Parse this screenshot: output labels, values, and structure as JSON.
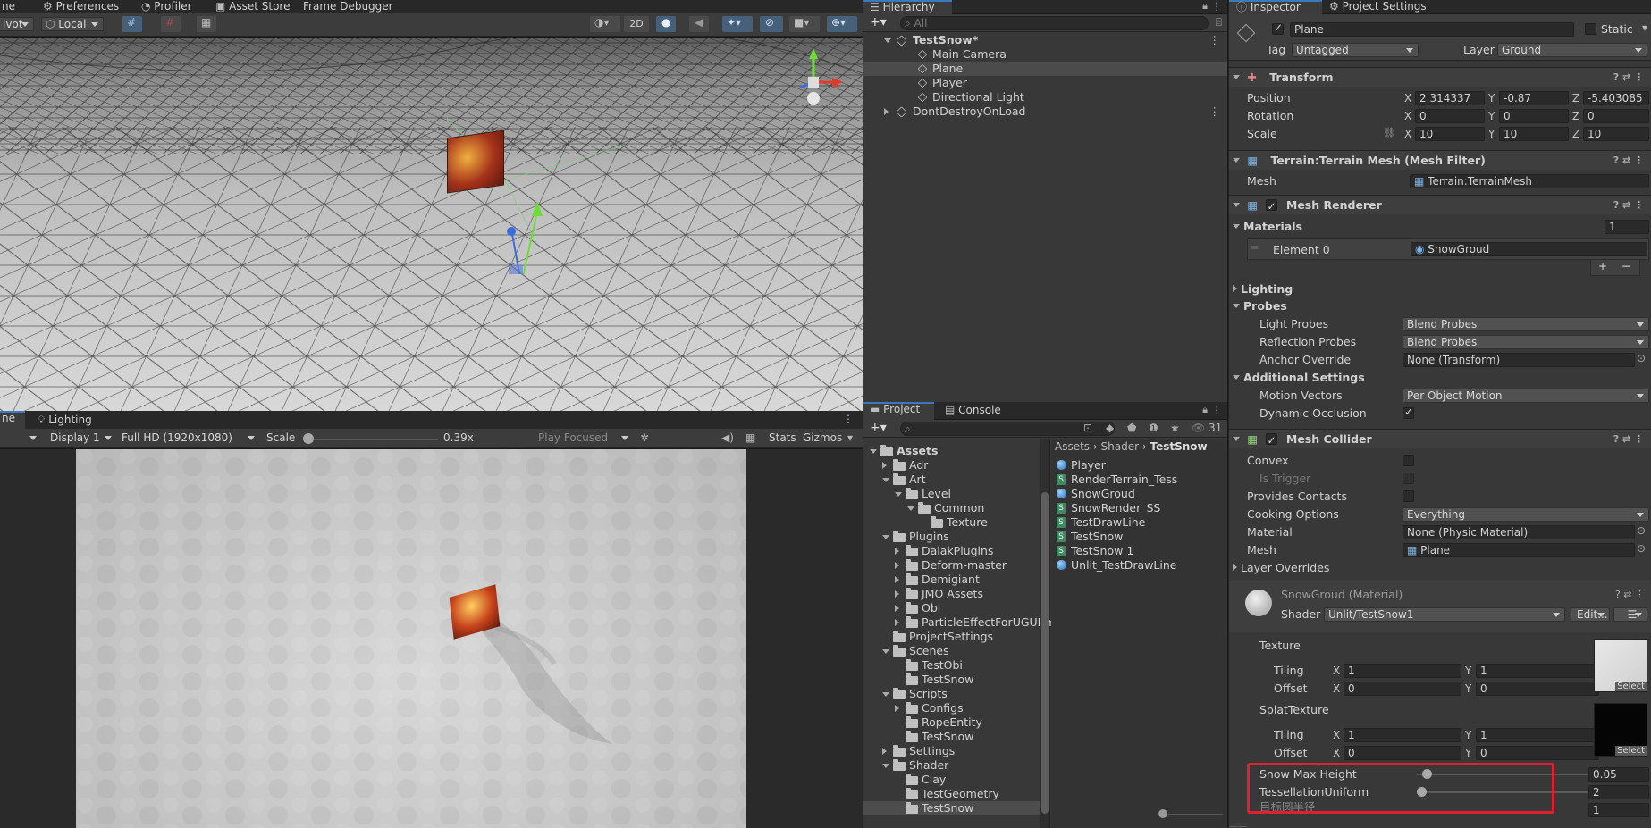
{
  "top_tabs": {
    "scene_tab": "ne",
    "preferences": "Preferences",
    "profiler": "Profiler",
    "asset_store": "Asset Store",
    "frame_debugger": "Frame Debugger"
  },
  "scene_toolbar": {
    "pivot": "ivot",
    "local": "Local",
    "mode_2d": "2D"
  },
  "game_view": {
    "tab_game": "ne",
    "tab_lighting": "Lighting",
    "display": "Display 1",
    "resolution": "Full HD (1920x1080)",
    "scale_label": "Scale",
    "scale_value": "0.39x",
    "scale_fraction": 0.03,
    "play_focused": "Play Focused",
    "stats": "Stats",
    "gizmos": "Gizmos"
  },
  "hierarchy": {
    "tab": "Hierarchy",
    "search_placeholder": "All",
    "items": [
      {
        "label": "TestSnow*",
        "type": "scene",
        "expanded": true
      },
      {
        "label": "Main Camera",
        "type": "object"
      },
      {
        "label": "Plane",
        "type": "object",
        "selected": true
      },
      {
        "label": "Player",
        "type": "object"
      },
      {
        "label": "Directional Light",
        "type": "object"
      },
      {
        "label": "DontDestroyOnLoad",
        "type": "scene",
        "expanded": false
      }
    ]
  },
  "project": {
    "tab_project": "Project",
    "tab_console": "Console",
    "hidden_count": "31",
    "breadcrumb": [
      "Assets",
      "Shader",
      "TestSnow"
    ],
    "tree": [
      {
        "label": "Assets",
        "arrow": "down",
        "bold": true
      },
      {
        "label": "Adr",
        "arrow": "right"
      },
      {
        "label": "Art",
        "arrow": "down"
      },
      {
        "label": "Level",
        "arrow": "down"
      },
      {
        "label": "Common",
        "arrow": "down"
      },
      {
        "label": "Texture",
        "arrow": ""
      },
      {
        "label": "Plugins",
        "arrow": "down"
      },
      {
        "label": "DalakPlugins",
        "arrow": "right"
      },
      {
        "label": "Deform-master",
        "arrow": "right"
      },
      {
        "label": "Demigiant",
        "arrow": "right"
      },
      {
        "label": "JMO Assets",
        "arrow": "right"
      },
      {
        "label": "Obi",
        "arrow": "right"
      },
      {
        "label": "ParticleEffectForUGUI-m",
        "arrow": "right"
      },
      {
        "label": "ProjectSettings",
        "arrow": ""
      },
      {
        "label": "Scenes",
        "arrow": "down"
      },
      {
        "label": "TestObi",
        "arrow": ""
      },
      {
        "label": "TestSnow",
        "arrow": ""
      },
      {
        "label": "Scripts",
        "arrow": "down"
      },
      {
        "label": "Configs",
        "arrow": "right"
      },
      {
        "label": "RopeEntity",
        "arrow": ""
      },
      {
        "label": "TestSnow",
        "arrow": ""
      },
      {
        "label": "Settings",
        "arrow": "right"
      },
      {
        "label": "Shader",
        "arrow": "down"
      },
      {
        "label": "Clay",
        "arrow": ""
      },
      {
        "label": "TestGeometry",
        "arrow": ""
      },
      {
        "label": "TestSnow",
        "arrow": "",
        "selected": true
      }
    ],
    "files": [
      {
        "label": "Player",
        "kind": "material"
      },
      {
        "label": "RenderTerrain_Tess",
        "kind": "shader"
      },
      {
        "label": "SnowGroud",
        "kind": "material"
      },
      {
        "label": "SnowRender_SS",
        "kind": "shader"
      },
      {
        "label": "TestDrawLine",
        "kind": "shader"
      },
      {
        "label": "TestSnow",
        "kind": "shader"
      },
      {
        "label": "TestSnow 1",
        "kind": "shader"
      },
      {
        "label": "Unlit_TestDrawLine",
        "kind": "material"
      }
    ]
  },
  "inspector": {
    "tab_inspector": "Inspector",
    "tab_project_settings": "Project Settings",
    "object_name": "Plane",
    "static_label": "Static",
    "tag_label": "Tag",
    "tag_value": "Untagged",
    "layer_label": "Layer",
    "layer_value": "Ground",
    "transform": {
      "title": "Transform",
      "position_label": "Position",
      "position": {
        "x": "2.314337",
        "y": "-0.87",
        "z": "-5.403085"
      },
      "rotation_label": "Rotation",
      "rotation": {
        "x": "0",
        "y": "0",
        "z": "0"
      },
      "scale_label": "Scale",
      "scale": {
        "x": "10",
        "y": "10",
        "z": "10"
      }
    },
    "mesh_filter": {
      "title": "Terrain:Terrain Mesh (Mesh Filter)",
      "mesh_label": "Mesh",
      "mesh_value": "Terrain:TerrainMesh"
    },
    "mesh_renderer": {
      "title": "Mesh Renderer",
      "materials_label": "Materials",
      "materials_count": "1",
      "element0_label": "Element 0",
      "element0_value": "SnowGroud",
      "lighting_label": "Lighting",
      "probes_label": "Probes",
      "light_probes_label": "Light Probes",
      "light_probes_value": "Blend Probes",
      "reflection_probes_label": "Reflection Probes",
      "reflection_probes_value": "Blend Probes",
      "anchor_override_label": "Anchor Override",
      "anchor_override_value": "None (Transform)",
      "additional_settings_label": "Additional Settings",
      "motion_vectors_label": "Motion Vectors",
      "motion_vectors_value": "Per Object Motion",
      "dynamic_occlusion_label": "Dynamic Occlusion"
    },
    "mesh_collider": {
      "title": "Mesh Collider",
      "convex_label": "Convex",
      "is_trigger_label": "Is Trigger",
      "provides_contacts_label": "Provides Contacts",
      "cooking_options_label": "Cooking Options",
      "cooking_options_value": "Everything",
      "material_label": "Material",
      "material_value": "None (Physic Material)",
      "mesh_label": "Mesh",
      "mesh_value": "Plane",
      "layer_overrides_label": "Layer Overrides"
    },
    "material": {
      "title": "SnowGroud (Material)",
      "shader_label": "Shader",
      "shader_value": "Unlit/TestSnow1",
      "edit_label": "Edit...",
      "texture_label": "Texture",
      "tiling_label": "Tiling",
      "offset_label": "Offset",
      "texture_tiling": {
        "x": "1",
        "y": "1"
      },
      "texture_offset": {
        "x": "0",
        "y": "0"
      },
      "splat_label": "SplatTexture",
      "splat_tiling": {
        "x": "1",
        "y": "1"
      },
      "splat_offset": {
        "x": "0",
        "y": "0"
      },
      "select_label": "Select",
      "snow_max_height_label": "Snow Max Height",
      "snow_max_height_value": "0.05",
      "tessellation_label": "TessellationUniform",
      "tessellation_value": "2",
      "cut_label": "目标圆半径",
      "cut_value": "1"
    }
  },
  "colors": {
    "highlight_box": "#e0202e",
    "accent_tab": "#3a79bb",
    "selection": "#2c5d87"
  }
}
